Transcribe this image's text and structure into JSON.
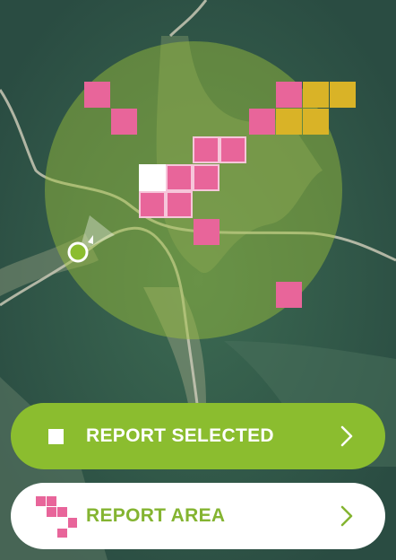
{
  "map": {
    "colors": {
      "forest": "#2f5447",
      "clearing": "#8d9a7c",
      "radius_fill": "#9fc43a",
      "cell_pink": "#e8659a",
      "cell_yellow": "#d9b327",
      "cell_white": "#ffffff",
      "location_dot": "#8bbd2f"
    },
    "selected_cell": "white",
    "location_icon": "location-dot-icon",
    "heading_icon": "heading-arrow-icon"
  },
  "actions": {
    "report_selected": {
      "label": "REPORT SELECTED",
      "icon": "square-icon",
      "chevron": "chevron-right-icon",
      "color": "#8bbd2f"
    },
    "report_area": {
      "label": "REPORT AREA",
      "icon": "area-cells-icon",
      "chevron": "chevron-right-icon",
      "color": "#ffffff"
    }
  }
}
